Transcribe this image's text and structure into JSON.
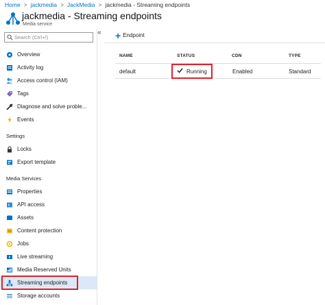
{
  "breadcrumb": [
    "Home",
    "jackmedia",
    "JackMedia",
    "jackmedia - Streaming endpoints"
  ],
  "header": {
    "title": "jackmedia - Streaming endpoints",
    "subtitle": "Media service"
  },
  "search": {
    "placeholder": "Search (Ctrl+/)"
  },
  "sidebar": {
    "collapse_glyph": "«",
    "items_top": [
      "Overview",
      "Activity log",
      "Access control (IAM)",
      "Tags",
      "Diagnose and solve proble...",
      "Events"
    ],
    "section_settings": "Settings",
    "items_settings": [
      "Locks",
      "Export template"
    ],
    "section_media": "Media Services",
    "items_media": [
      "Properties",
      "API access",
      "Assets",
      "Content protection",
      "Jobs",
      "Live streaming",
      "Media Reserved Units",
      "Streaming endpoints",
      "Storage accounts"
    ]
  },
  "toolbar": {
    "add_label": "Endpoint"
  },
  "table": {
    "columns": [
      "NAME",
      "STATUS",
      "CDN",
      "TYPE"
    ],
    "rows": [
      {
        "name": "default",
        "status": "Running",
        "cdn": "Enabled",
        "type": "Standard"
      }
    ]
  },
  "colors": {
    "accent": "#0072c6",
    "highlight": "#e0202a",
    "selected": "#dbe9f6"
  }
}
